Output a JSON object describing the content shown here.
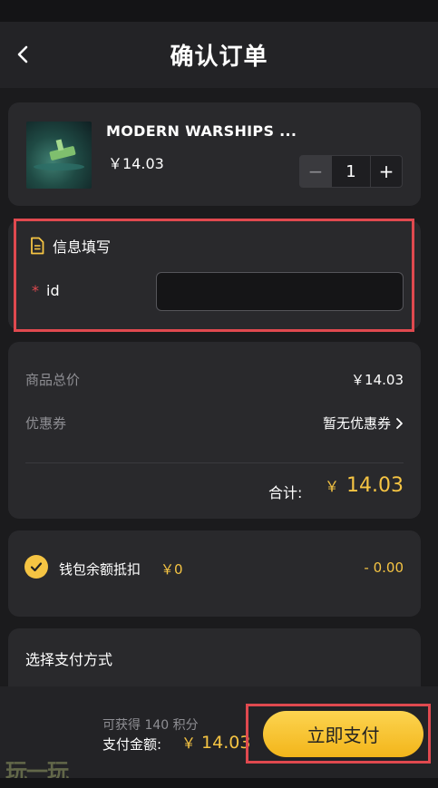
{
  "header": {
    "title": "确认订单"
  },
  "product": {
    "name": "MODERN WARSHIPS ...",
    "price": "￥14.03",
    "quantity": "1",
    "minus": "−",
    "plus": "+"
  },
  "info": {
    "title": "信息填写",
    "required_mark": "*",
    "field_label": "id",
    "field_value": ""
  },
  "summary": {
    "goods_total_label": "商品总价",
    "goods_total_value": "￥14.03",
    "coupon_label": "优惠券",
    "coupon_value": "暂无优惠券",
    "total_label": "合计:",
    "total_currency": "￥",
    "total_value": "14.03"
  },
  "wallet": {
    "label": "钱包余额抵扣",
    "balance": "￥0",
    "deduction": "- 0.00",
    "checked": true
  },
  "payment": {
    "title": "选择支付方式"
  },
  "bottom": {
    "points": "可获得 140 积分",
    "pay_label": "支付金额:",
    "pay_currency": "￥",
    "pay_value": "14.03",
    "pay_button": "立即支付"
  },
  "watermark": "玩一玩",
  "colors": {
    "accent": "#f5c443",
    "highlight": "#e0494f",
    "card": "#29292c",
    "background": "#1b1b1d"
  }
}
